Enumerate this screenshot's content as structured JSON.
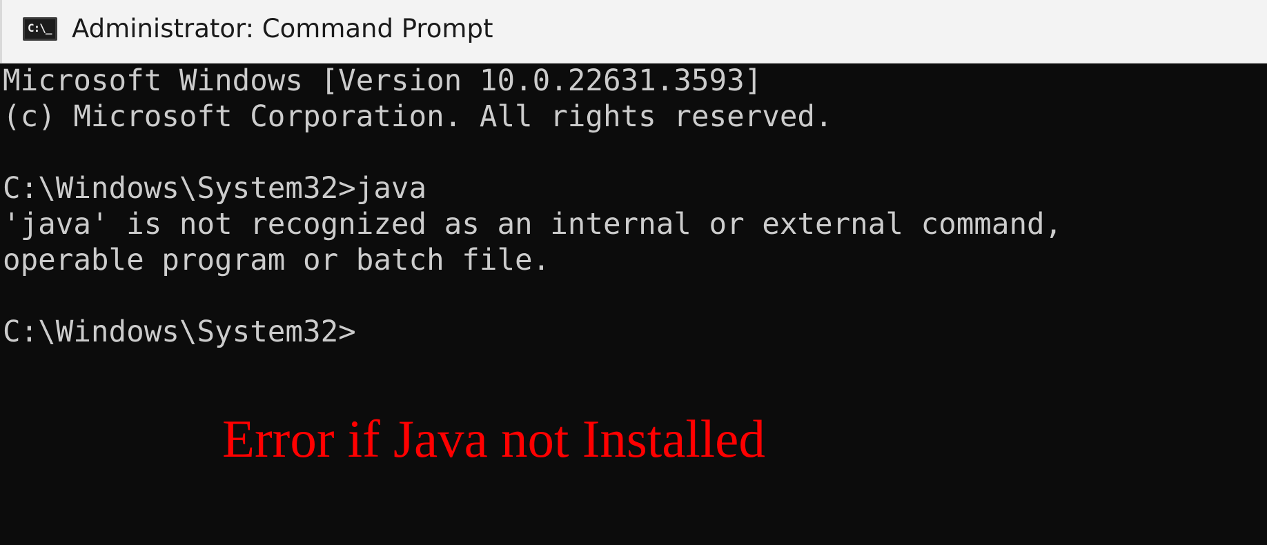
{
  "window": {
    "title": "Administrator: Command Prompt",
    "icon": "cmd-icon",
    "icon_glyph": "C:\\_"
  },
  "console": {
    "lines": [
      "Microsoft Windows [Version 10.0.22631.3593]",
      "(c) Microsoft Corporation. All rights reserved.",
      "",
      "C:\\Windows\\System32>java",
      "'java' is not recognized as an internal or external command,",
      "operable program or batch file.",
      "",
      "C:\\Windows\\System32>"
    ]
  },
  "annotation": {
    "text": "Error if Java not Installed",
    "color": "#ff0000"
  },
  "colors": {
    "console_background": "#0c0c0c",
    "console_text": "#cccccc",
    "titlebar_background": "#f3f3f3"
  }
}
